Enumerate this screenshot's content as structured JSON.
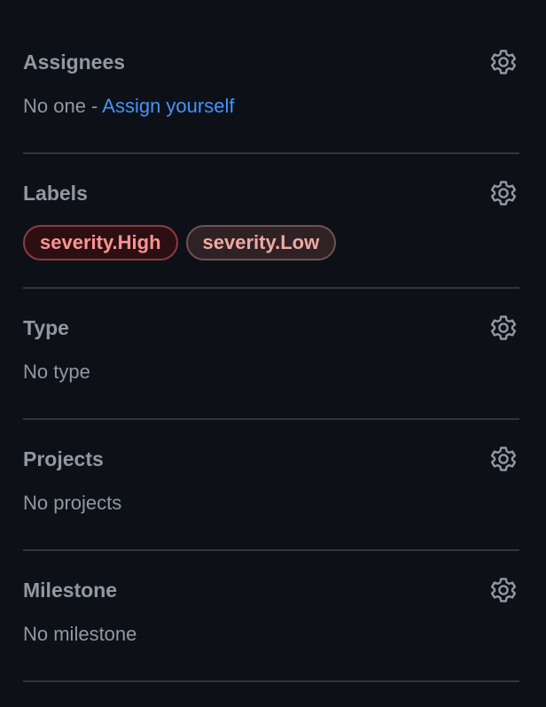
{
  "sections": [
    {
      "title": "Assignees",
      "value_prefix": "No one - ",
      "value_link": "Assign yourself"
    },
    {
      "title": "Labels",
      "labels": [
        {
          "name": "severity.High",
          "text_color": "#ff9492",
          "bg_color": "#2b0f12",
          "border_color": "#8e3b3f"
        },
        {
          "name": "severity.Low",
          "text_color": "#f0a8a4",
          "bg_color": "#2e2224",
          "border_color": "#6f5254"
        }
      ]
    },
    {
      "title": "Type",
      "value": "No type"
    },
    {
      "title": "Projects",
      "value": "No projects"
    },
    {
      "title": "Milestone",
      "value": "No milestone"
    }
  ],
  "icons": {
    "settings": "gear-icon"
  },
  "colors": {
    "background": "#0d1117",
    "text_muted": "#9198a1",
    "link": "#4493f8",
    "divider": "#30363d"
  }
}
